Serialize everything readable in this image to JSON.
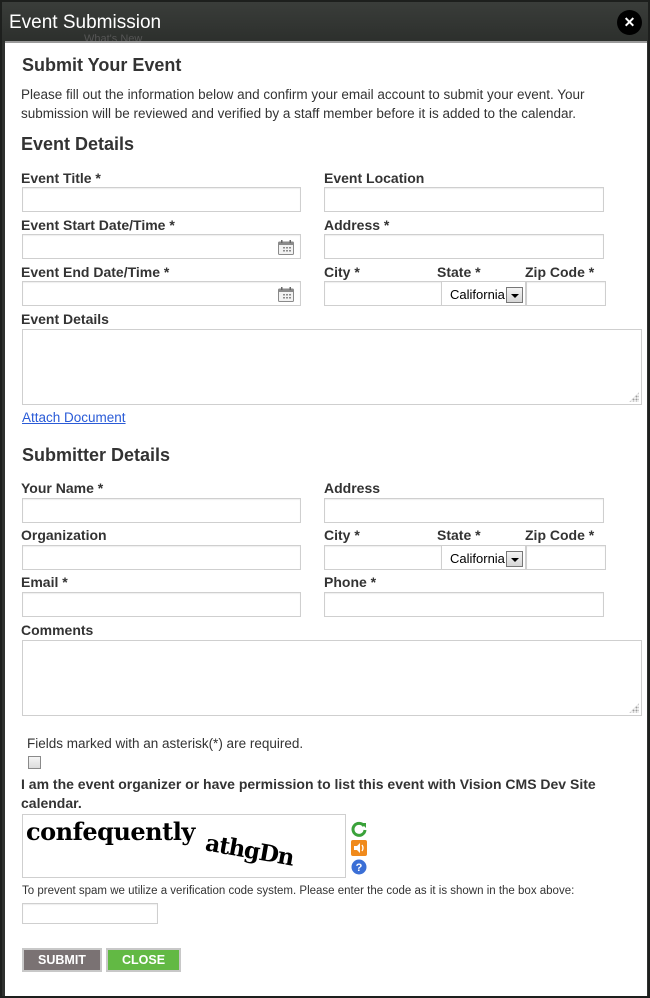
{
  "window": {
    "title": "Event Submission",
    "background_text": "What's New",
    "close_icon": "close-icon"
  },
  "header": {
    "title": "Submit Your Event",
    "intro": "Please fill out the information below and confirm your email account to submit your event. Your submission will be reviewed and verified by a staff member before it is added to the calendar."
  },
  "event_details": {
    "heading": "Event Details",
    "event_title": {
      "label": "Event Title *",
      "value": ""
    },
    "event_location": {
      "label": "Event Location",
      "value": ""
    },
    "start": {
      "label": "Event Start Date/Time *",
      "value": "",
      "icon": "calendar-icon"
    },
    "address": {
      "label": "Address *",
      "value": ""
    },
    "end": {
      "label": "Event End Date/Time *",
      "value": "",
      "icon": "calendar-icon"
    },
    "city": {
      "label": "City *",
      "value": ""
    },
    "state": {
      "label": "State *",
      "selected": "California"
    },
    "zip": {
      "label": "Zip Code *",
      "value": ""
    },
    "details": {
      "label": "Event Details",
      "value": ""
    },
    "attach_link": "Attach Document"
  },
  "submitter_details": {
    "heading": "Submitter Details",
    "name": {
      "label": "Your Name *",
      "value": ""
    },
    "address": {
      "label": "Address",
      "value": ""
    },
    "organization": {
      "label": "Organization",
      "value": ""
    },
    "city": {
      "label": "City *",
      "value": ""
    },
    "state": {
      "label": "State *",
      "selected": "California"
    },
    "zip": {
      "label": "Zip Code *",
      "value": ""
    },
    "email": {
      "label": "Email *",
      "value": ""
    },
    "phone": {
      "label": "Phone *",
      "value": ""
    },
    "comments": {
      "label": "Comments",
      "value": ""
    }
  },
  "footer": {
    "required_note": "Fields marked with an asterisk(*) are required.",
    "permission_checked": false,
    "permission_text": "I am the event organizer or have permission to list this event with Vision CMS Dev Site calendar.",
    "captcha": {
      "word1": "confequently",
      "word2": "athgDn",
      "icons": [
        "refresh-icon",
        "audio-icon",
        "help-icon"
      ]
    },
    "captcha_instructions": "To prevent spam we utilize a verification code system. Please enter the code as it is shown in the box above:",
    "captcha_value": "",
    "submit_label": "SUBMIT",
    "close_label": "CLOSE"
  },
  "colors": {
    "submit": "#7a7273",
    "close": "#62b944",
    "link": "#2a5bd7",
    "titlebar": "#2f312f"
  }
}
